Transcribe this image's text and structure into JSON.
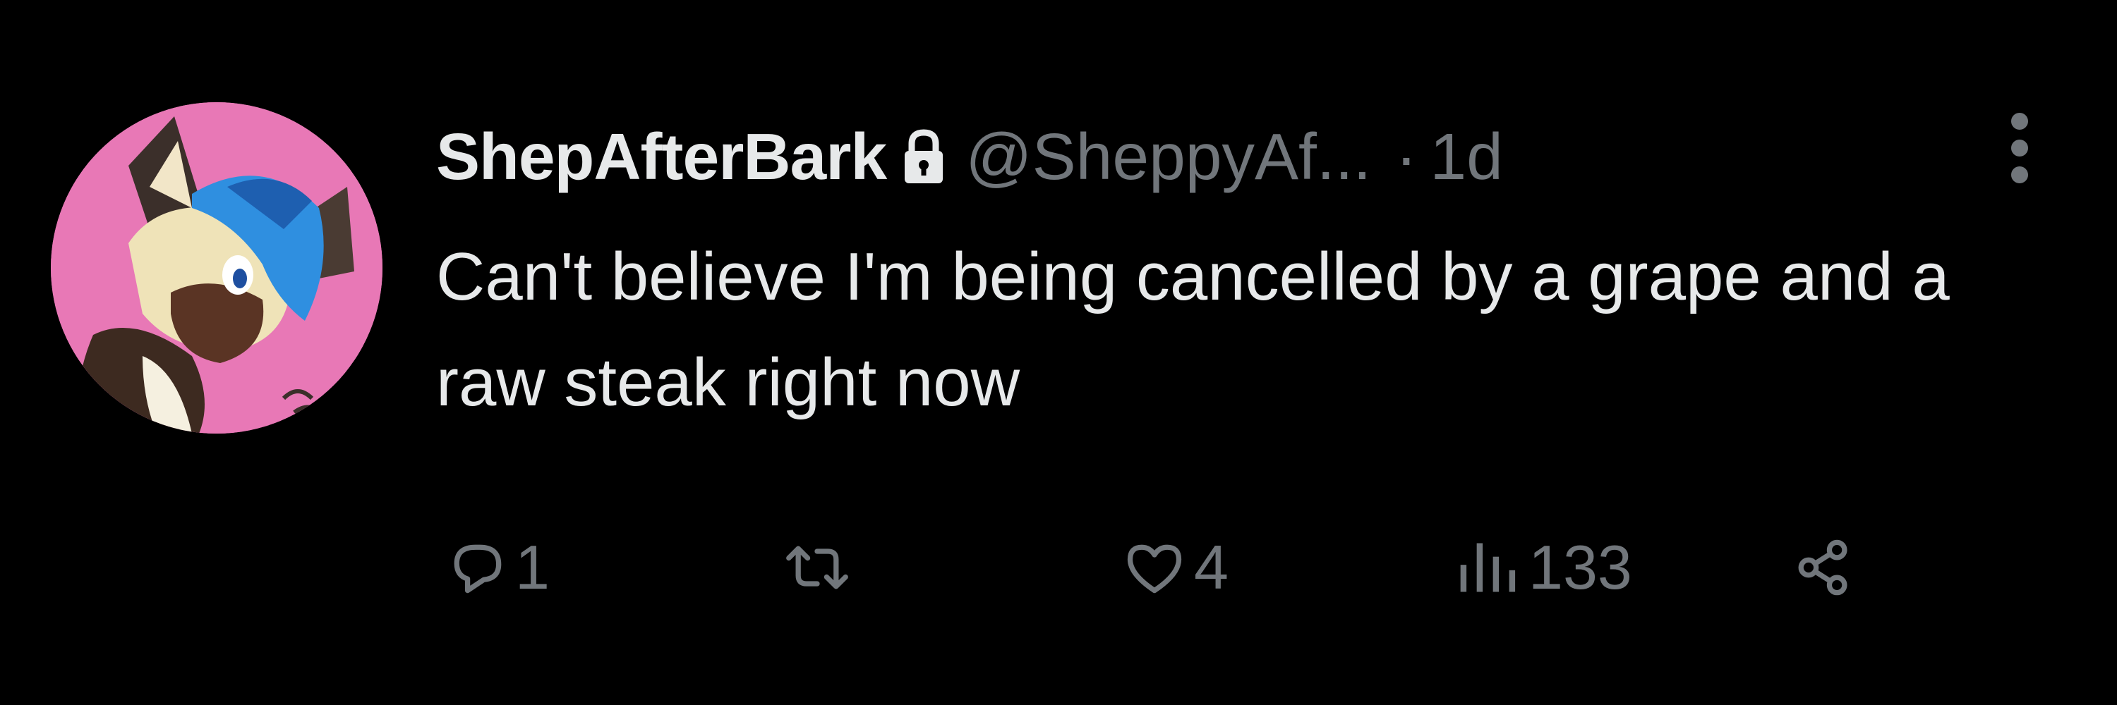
{
  "tweet": {
    "display_name": "ShepAfterBark",
    "protected_icon": "lock-icon",
    "handle": "@SheppyAf...",
    "separator": "·",
    "time": "1d",
    "more_icon": "more-vertical-icon",
    "text": "Can't believe I'm being cancelled by a grape and a raw steak right now",
    "avatar": "avatar-cartoon-dog-character"
  },
  "actions": {
    "reply": {
      "icon": "reply-icon",
      "count": "1"
    },
    "retweet": {
      "icon": "retweet-icon",
      "count": ""
    },
    "like": {
      "icon": "heart-icon",
      "count": "4"
    },
    "views": {
      "icon": "views-bar-chart-icon",
      "count": "133"
    },
    "share": {
      "icon": "share-icon"
    }
  },
  "colors": {
    "background": "#000000",
    "primary_text": "#e7e9ea",
    "secondary_text": "#71767b",
    "avatar_background": "#e878b6"
  }
}
